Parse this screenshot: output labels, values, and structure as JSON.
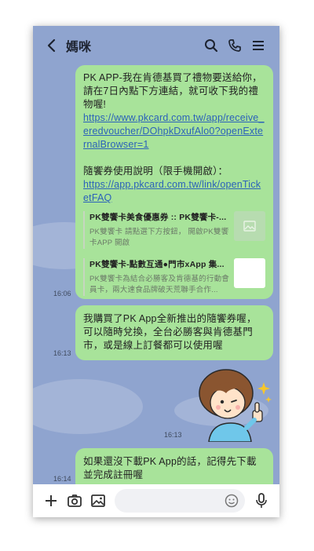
{
  "header": {
    "title": "媽咪"
  },
  "messages": [
    {
      "time": "16:06",
      "line1": "PK APP-我在肯德基買了禮物要送給你，請在7日內點下方連結，就可收下我的禮物喔!",
      "link1": "https://www.pkcard.com.tw/app/receive_eredvoucher/DOhpkDxufAlo0?openExternalBrowser=1",
      "line2": "隨饗券使用說明（限手機開啟）：",
      "link2": "https://app.pkcard.com.tw/link/openTicketFAQ",
      "cards": [
        {
          "title": "PK雙饗卡美食優惠券 :: PK雙饗卡-...",
          "desc": "PK雙饗卡 請點選下方按鈕， 開啟PK雙饗卡APP 開啟"
        },
        {
          "title": "PK雙饗卡-點數互通●門市xApp 集...",
          "desc": "PK雙饗卡為結合必勝客及肯德基的行動會員卡，兩大速食品牌破天荒聯手合作..."
        }
      ]
    },
    {
      "time": "16:13",
      "text": "我購買了PK App全新推出的隨饗券喔，可以隨時兌換，全台必勝客與肯德基門市，或是線上訂餐都可以使用喔"
    },
    {
      "time": "16:13",
      "sticker": "smiling-girl-thumbs-up"
    },
    {
      "time": "16:14",
      "text": "如果還沒下載PK App的話，記得先下載並完成註冊喔"
    }
  ],
  "icons": {
    "back": "chevron-left-icon",
    "search": "search-icon",
    "call": "phone-icon",
    "menu": "menu-icon",
    "add": "plus-icon",
    "camera": "camera-icon",
    "image": "image-icon",
    "emoji": "emoji-icon",
    "mic": "microphone-icon"
  },
  "colors": {
    "chat_bg": "#8fa4cf",
    "bubble": "#a8e39a",
    "link": "#2b62b9"
  }
}
